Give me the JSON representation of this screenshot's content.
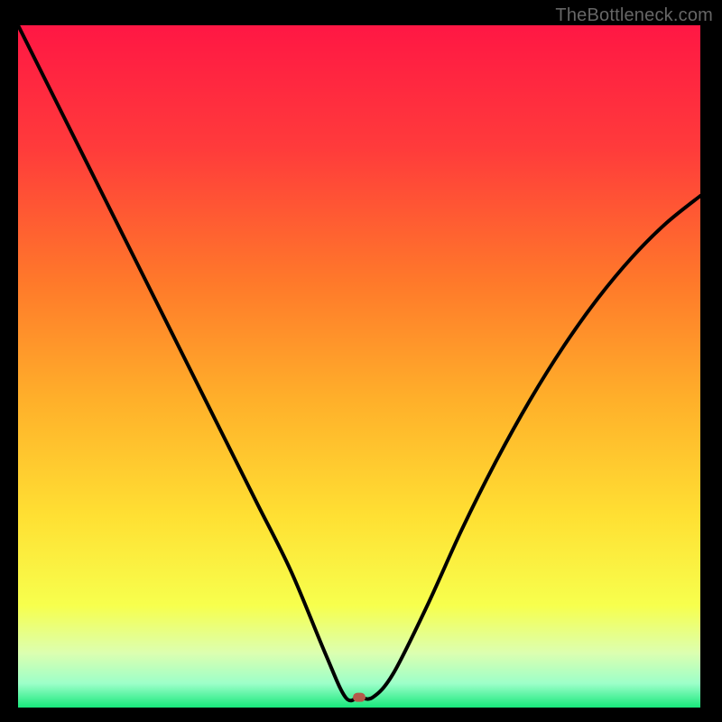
{
  "watermark": "TheBottleneck.com",
  "chart_data": {
    "type": "line",
    "title": "",
    "xlabel": "",
    "ylabel": "",
    "xlim": [
      0,
      100
    ],
    "ylim": [
      0,
      100
    ],
    "annotations": [],
    "series": [
      {
        "name": "bottleneck-curve",
        "x": [
          0,
          5,
          10,
          15,
          20,
          25,
          30,
          35,
          40,
          45,
          48,
          50,
          52,
          55,
          60,
          65,
          70,
          75,
          80,
          85,
          90,
          95,
          100
        ],
        "values": [
          100,
          90,
          80,
          70,
          60,
          50,
          40,
          30,
          20,
          8,
          1.5,
          1.5,
          1.5,
          5,
          15,
          26,
          36,
          45,
          53,
          60,
          66,
          71,
          75
        ]
      }
    ],
    "marker": {
      "x": 50,
      "y": 1.5,
      "color": "#b45a4a"
    },
    "background_gradient": {
      "stops": [
        {
          "pos": 0.0,
          "color": "#ff1744"
        },
        {
          "pos": 0.18,
          "color": "#ff3b3b"
        },
        {
          "pos": 0.38,
          "color": "#ff7a2a"
        },
        {
          "pos": 0.55,
          "color": "#ffb02a"
        },
        {
          "pos": 0.72,
          "color": "#ffe033"
        },
        {
          "pos": 0.85,
          "color": "#f7ff4d"
        },
        {
          "pos": 0.92,
          "color": "#dcffb0"
        },
        {
          "pos": 0.965,
          "color": "#9cffc9"
        },
        {
          "pos": 1.0,
          "color": "#18e87b"
        }
      ]
    }
  }
}
